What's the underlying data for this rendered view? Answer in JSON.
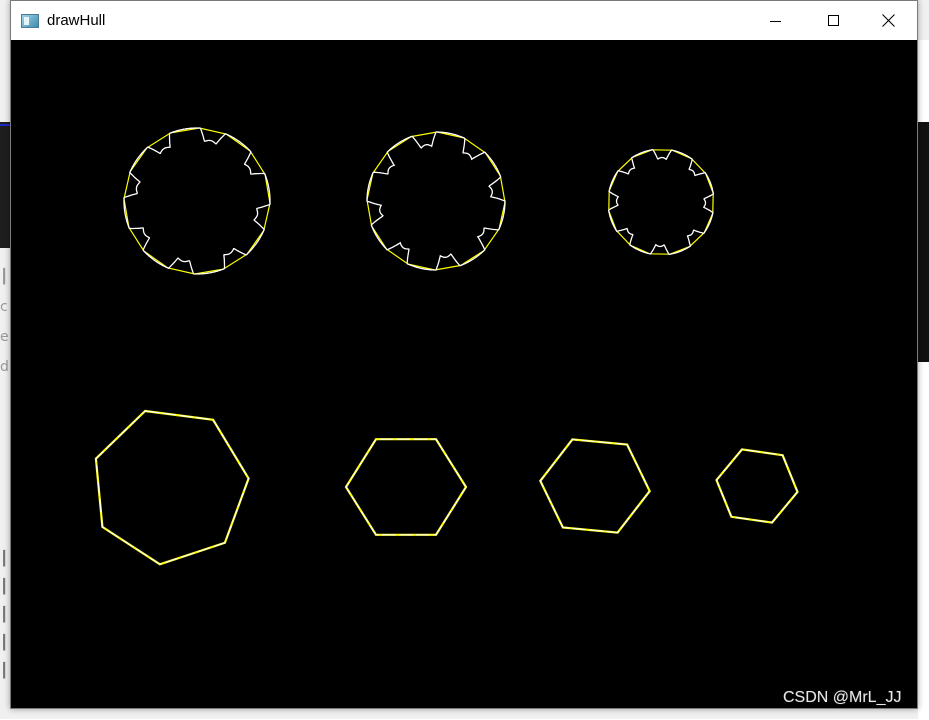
{
  "window": {
    "title": "drawHull",
    "icon": "app-window-icon"
  },
  "controls": {
    "minimize_icon": "minimize-icon",
    "maximize_icon": "maximize-icon",
    "close_icon": "close-icon"
  },
  "canvas": {
    "background": "#000000",
    "contour_color": "#ffffff",
    "hull_color": "#ffff00",
    "shapes": [
      {
        "name": "gear-large",
        "kind": "gear",
        "teeth": 8
      },
      {
        "name": "gear-medium",
        "kind": "gear",
        "teeth": 8
      },
      {
        "name": "gear-small",
        "kind": "gear",
        "teeth": 8
      },
      {
        "name": "heptagon",
        "kind": "polygon",
        "sides": 7
      },
      {
        "name": "hexagon-large",
        "kind": "polygon",
        "sides": 6
      },
      {
        "name": "hexagon-medium",
        "kind": "polygon",
        "sides": 6
      },
      {
        "name": "hexagon-small",
        "kind": "polygon",
        "sides": 6
      }
    ]
  },
  "watermark": "CSDN @MrL_JJ"
}
